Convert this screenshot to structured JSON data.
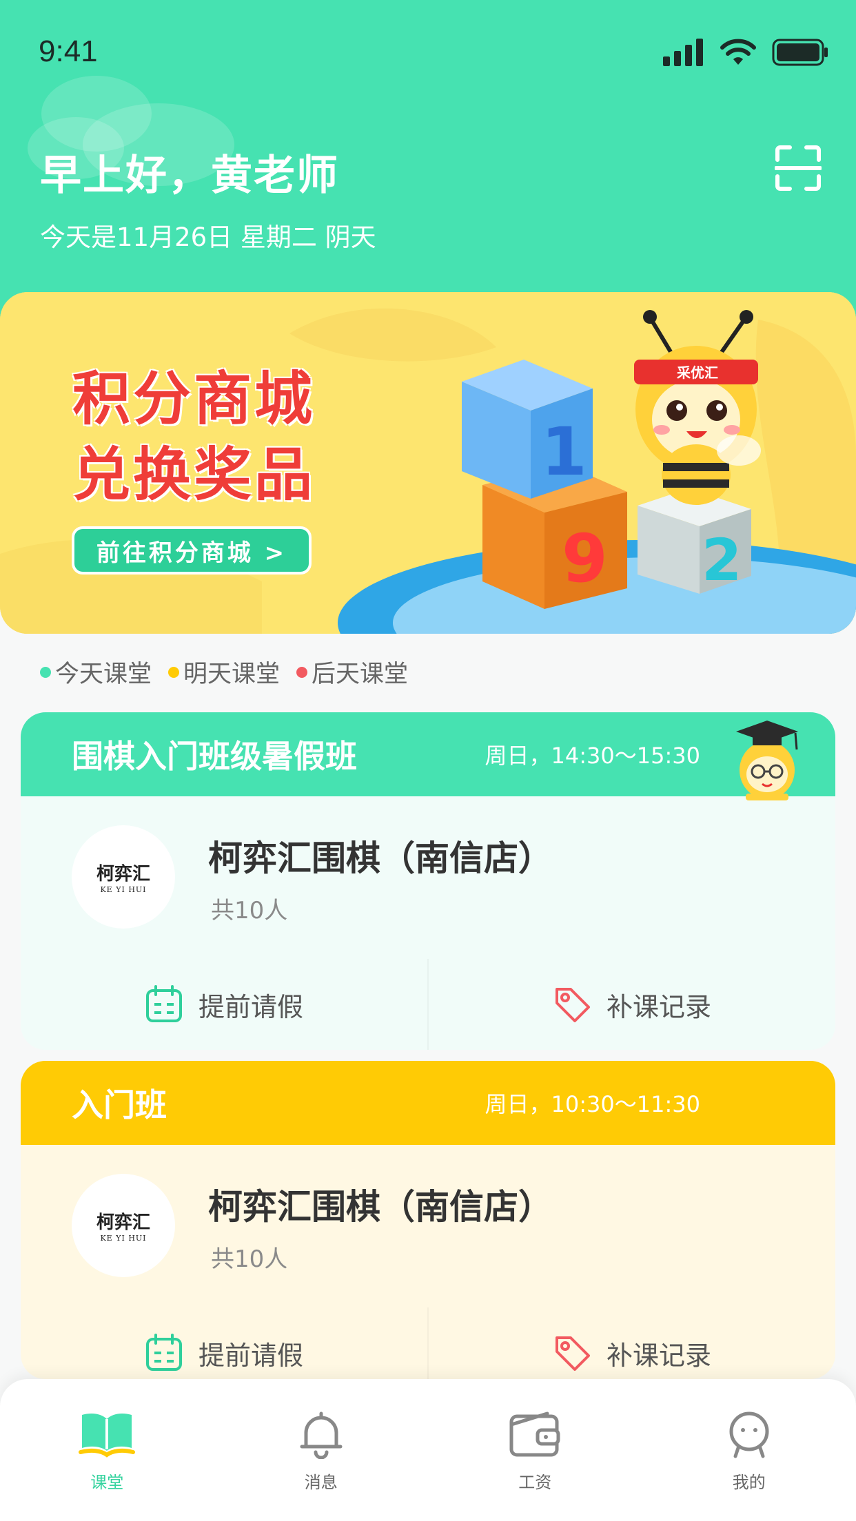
{
  "status_bar": {
    "time": "9:41"
  },
  "header": {
    "greeting": "早上好，黄老师",
    "date_line": "今天是11月26日 星期二 阴天"
  },
  "banner": {
    "title_line1": "积分商城",
    "title_line2": "兑换奖品",
    "button_label": "前往积分商城 >",
    "mascot_headband": "采优汇",
    "blocks": [
      "1",
      "9",
      "2"
    ]
  },
  "legend": [
    {
      "label": "今天课堂",
      "color": "#46e2b1"
    },
    {
      "label": "明天课堂",
      "color": "#ffcb05"
    },
    {
      "label": "后天课堂",
      "color": "#f25a60"
    }
  ],
  "classes": [
    {
      "title": "围棋入门班级暑假班",
      "time": "周日，14:30～15:30",
      "school": "柯弈汇围棋（南信店）",
      "count": "共10人",
      "logo_text": "柯弈汇",
      "logo_sub": "KE YI HUI",
      "leave_label": "提前请假",
      "makeup_label": "补课记录",
      "head_color": "#46e2b1",
      "body_color": "#f1fcf9"
    },
    {
      "title": "入门班",
      "time": "周日，10:30～11:30",
      "school": "柯弈汇围棋（南信店）",
      "count": "共10人",
      "logo_text": "柯弈汇",
      "logo_sub": "KE YI HUI",
      "leave_label": "提前请假",
      "makeup_label": "补课记录",
      "head_color": "#ffcb05",
      "body_color": "#fff8e3"
    }
  ],
  "tabbar": [
    {
      "label": "课堂",
      "icon": "book-icon",
      "active": true
    },
    {
      "label": "消息",
      "icon": "bell-icon",
      "active": false
    },
    {
      "label": "工资",
      "icon": "wallet-icon",
      "active": false
    },
    {
      "label": "我的",
      "icon": "profile-icon",
      "active": false
    }
  ]
}
